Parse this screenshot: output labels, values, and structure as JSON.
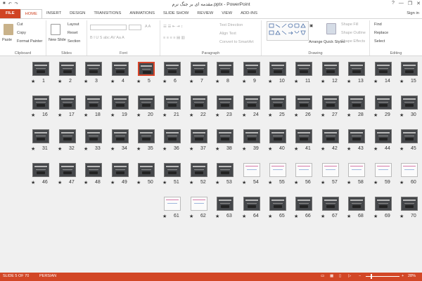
{
  "window": {
    "title": "مقدمه ای بر جنگ نرم.pptx - PowerPoint",
    "controls": [
      "?",
      "—",
      "❐",
      "✕"
    ]
  },
  "tabs": [
    {
      "label": "FILE"
    },
    {
      "label": "HOME"
    },
    {
      "label": "INSERT"
    },
    {
      "label": "DESIGN"
    },
    {
      "label": "TRANSITIONS"
    },
    {
      "label": "ANIMATIONS"
    },
    {
      "label": "SLIDE SHOW"
    },
    {
      "label": "REVIEW"
    },
    {
      "label": "VIEW"
    },
    {
      "label": "ADD-INS"
    }
  ],
  "signin": "Sign in",
  "ribbon": {
    "clipboard": {
      "label": "Clipboard",
      "paste": "Paste",
      "cut": "Cut",
      "copy": "Copy",
      "format_painter": "Format Painter"
    },
    "slides": {
      "label": "Slides",
      "new_slide": "New Slide",
      "layout": "Layout",
      "reset": "Reset",
      "section": "Section"
    },
    "font": {
      "label": "Font"
    },
    "paragraph": {
      "label": "Paragraph",
      "text_direction": "Text Direction",
      "align_text": "Align Text",
      "convert_smartart": "Convert to SmartArt"
    },
    "drawing": {
      "label": "Drawing",
      "arrange": "Arrange",
      "quick_styles": "Quick Styles",
      "shape_fill": "Shape Fill",
      "shape_outline": "Shape Outline",
      "shape_effects": "Shape Effects"
    },
    "editing": {
      "label": "Editing",
      "find": "Find",
      "replace": "Replace",
      "select": "Select"
    }
  },
  "slide_rows": [
    {
      "numbers": [
        "15",
        "14",
        "13",
        "12",
        "11",
        "10",
        "9",
        "8",
        "7",
        "6",
        "5",
        "4",
        "3",
        "2",
        "1"
      ],
      "white": [],
      "selected": [
        "5"
      ]
    },
    {
      "numbers": [
        "30",
        "29",
        "28",
        "27",
        "26",
        "25",
        "24",
        "23",
        "22",
        "21",
        "20",
        "19",
        "18",
        "17",
        "16"
      ],
      "white": [],
      "selected": []
    },
    {
      "numbers": [
        "45",
        "44",
        "43",
        "42",
        "41",
        "40",
        "39",
        "38",
        "37",
        "36",
        "35",
        "34",
        "33",
        "32",
        "31"
      ],
      "white": [],
      "selected": []
    },
    {
      "numbers": [
        "60",
        "59",
        "58",
        "57",
        "56",
        "55",
        "54",
        "53",
        "52",
        "51",
        "50",
        "49",
        "48",
        "47",
        "46"
      ],
      "white": [
        "60",
        "59",
        "58",
        "57",
        "56",
        "55",
        "54"
      ],
      "selected": []
    },
    {
      "numbers": [
        "70",
        "69",
        "68",
        "67",
        "66",
        "65",
        "64",
        "63",
        "62",
        "61"
      ],
      "white": [
        "62",
        "61"
      ],
      "selected": []
    }
  ],
  "star_glyph": "★",
  "status": {
    "slide_info": "SLIDE 5 OF 70",
    "language": "PERSIAN",
    "zoom": "28%"
  }
}
